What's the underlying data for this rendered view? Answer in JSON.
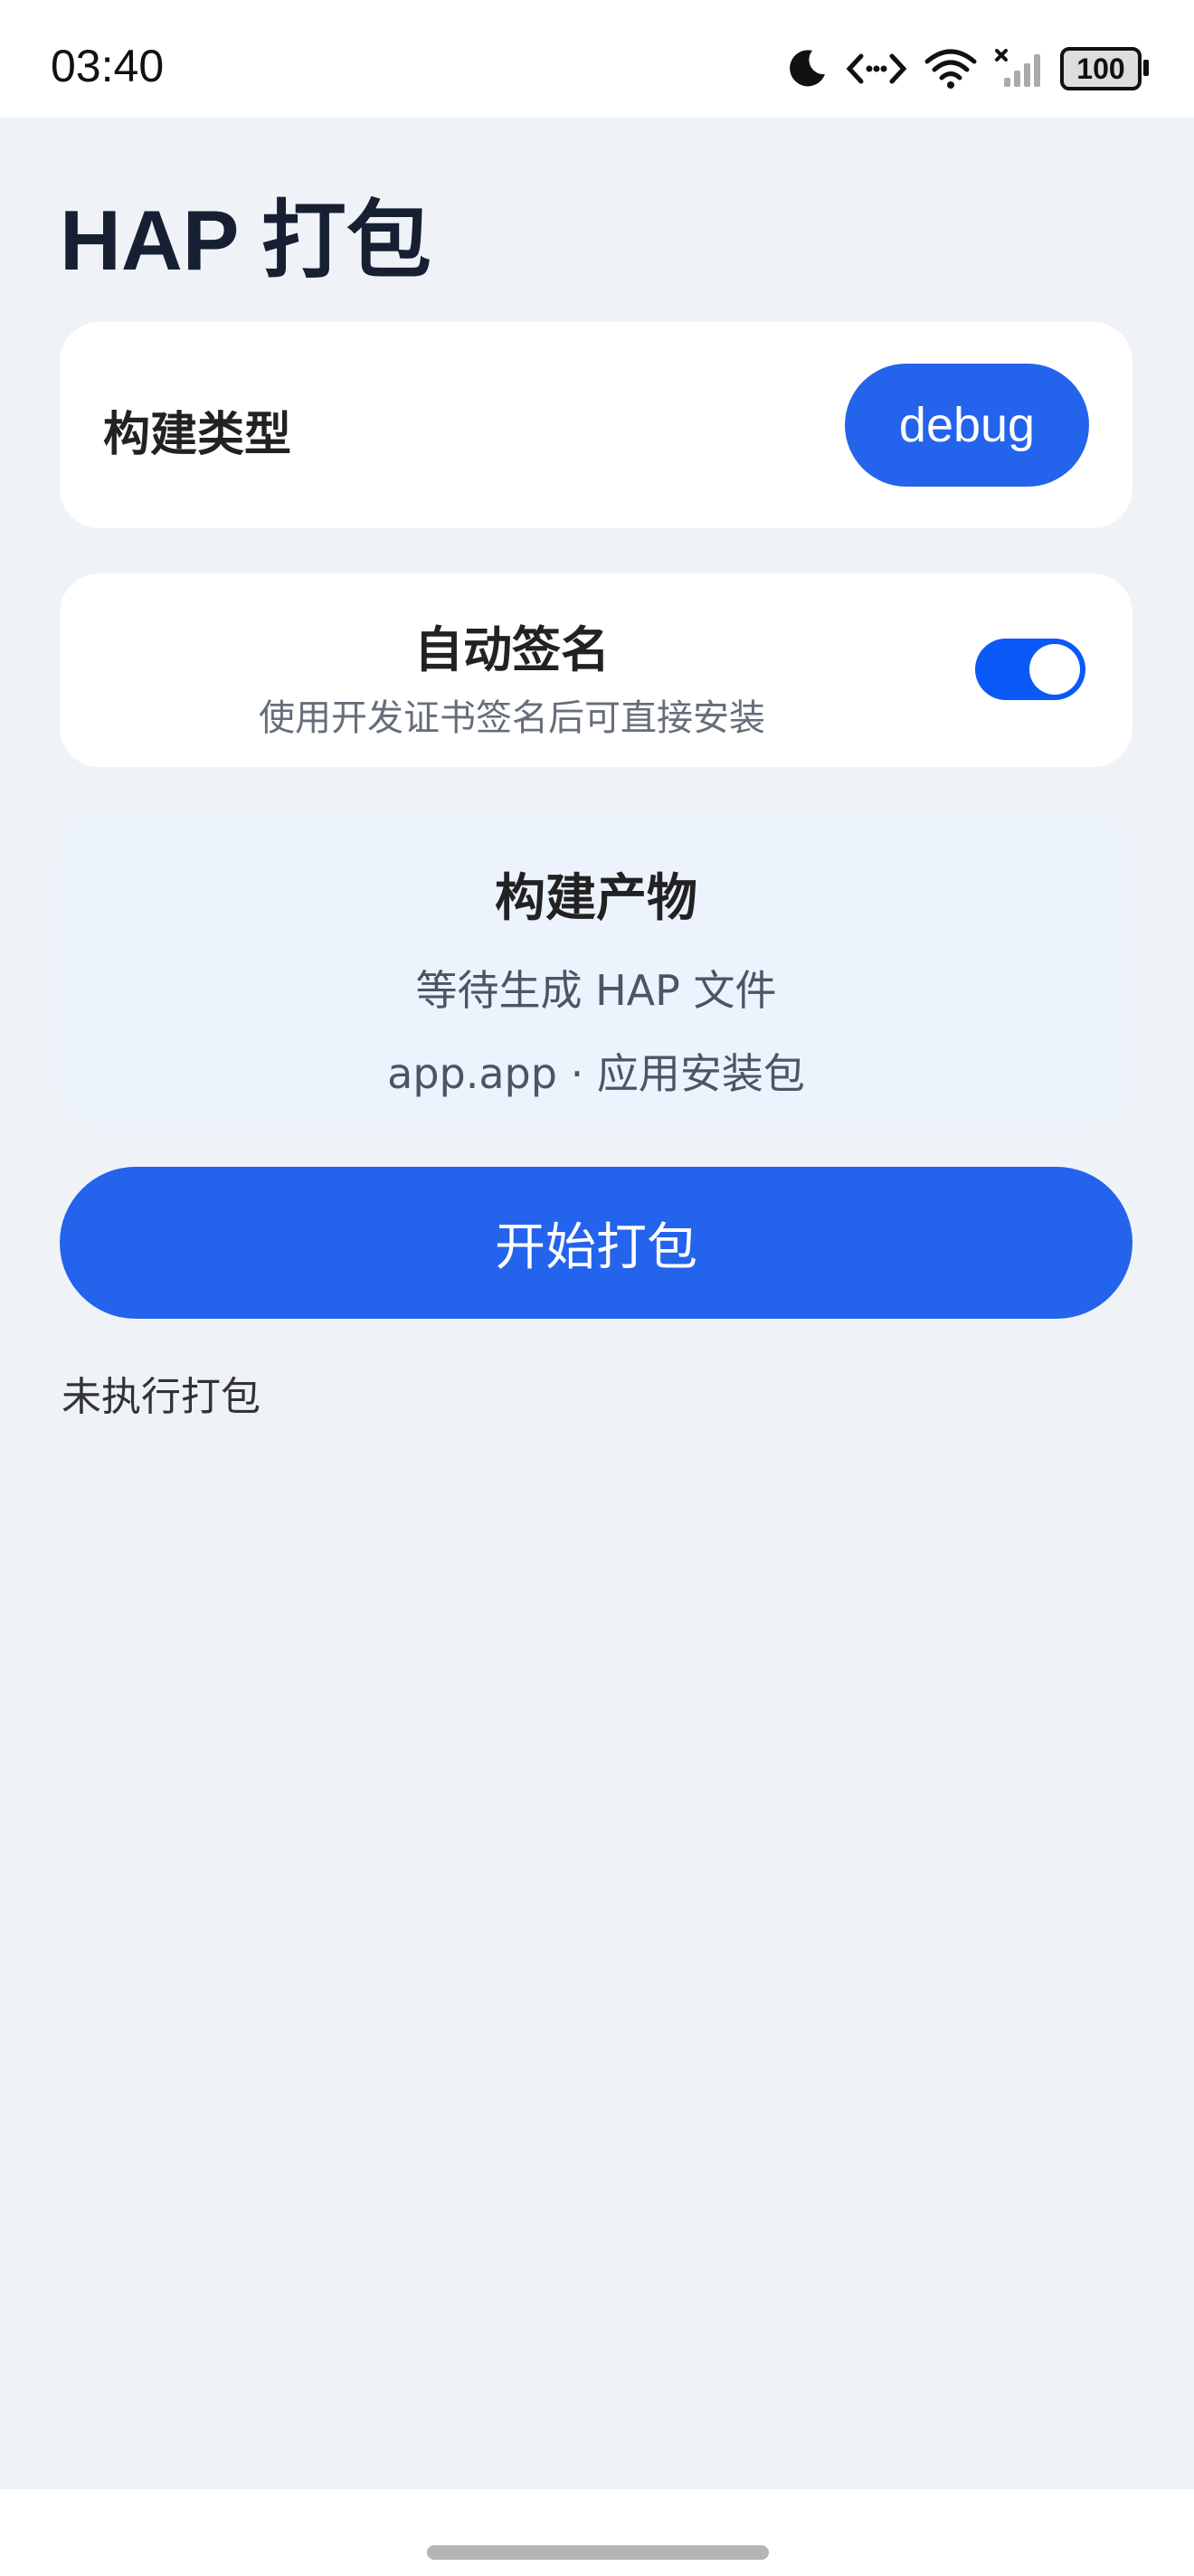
{
  "status_bar": {
    "time": "03:40",
    "battery": "100",
    "icons": [
      "moon-icon",
      "code-arrows-icon",
      "wifi-icon",
      "signal-icon",
      "battery-icon"
    ]
  },
  "page": {
    "title": "HAP 打包"
  },
  "build_type": {
    "label": "构建类型",
    "value": "debug"
  },
  "auto_sign": {
    "title": "自动签名",
    "subtitle": "使用开发证书签名后可直接安装",
    "enabled": true
  },
  "artifact": {
    "title": "构建产物",
    "status": "等待生成 HAP 文件",
    "package": "app.app · 应用安装包"
  },
  "actions": {
    "start_label": "开始打包"
  },
  "result": {
    "status_text": "未执行打包"
  },
  "colors": {
    "accent": "#2463eb",
    "toggle_on": "#0a59f7",
    "background": "#eff3f8",
    "artifact_card": "#edf3fd"
  }
}
